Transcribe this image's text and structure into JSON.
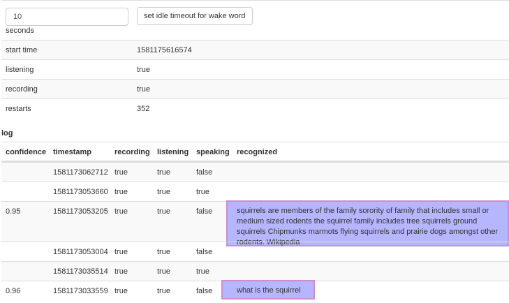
{
  "timeout": {
    "value": "10",
    "unit": "seconds",
    "button": "set idle timeout for wake word"
  },
  "status": [
    {
      "key": "start time",
      "value": "1581175616574"
    },
    {
      "key": "listening",
      "value": "true"
    },
    {
      "key": "recording",
      "value": "true"
    },
    {
      "key": "restarts",
      "value": "352"
    }
  ],
  "log": {
    "title": "log",
    "headers": [
      "confidence",
      "timestamp",
      "recording",
      "listening",
      "speaking",
      "recognized"
    ],
    "rows": [
      {
        "confidence": "",
        "timestamp": "1581173062712",
        "recording": "true",
        "listening": "true",
        "speaking": "false",
        "recognized": ""
      },
      {
        "confidence": "",
        "timestamp": "1581173053660",
        "recording": "true",
        "listening": "true",
        "speaking": "true",
        "recognized": ""
      },
      {
        "confidence": "0.95",
        "timestamp": "1581173053205",
        "recording": "true",
        "listening": "true",
        "speaking": "false",
        "recognized": "squirrels are members of the family sorority of family that includes small or medium sized rodents the squirrel family includes tree squirrels ground squirrels Chipmunks marmots flying squirrels and prairie dogs amongst other rodents. Wikipedia"
      },
      {
        "confidence": "",
        "timestamp": "1581173053004",
        "recording": "true",
        "listening": "true",
        "speaking": "false",
        "recognized": ""
      },
      {
        "confidence": "",
        "timestamp": "1581173035514",
        "recording": "true",
        "listening": "true",
        "speaking": "true",
        "recognized": ""
      },
      {
        "confidence": "0.96",
        "timestamp": "1581173033559",
        "recording": "true",
        "listening": "true",
        "speaking": "false",
        "recognized": "what is the squirrel"
      }
    ]
  }
}
